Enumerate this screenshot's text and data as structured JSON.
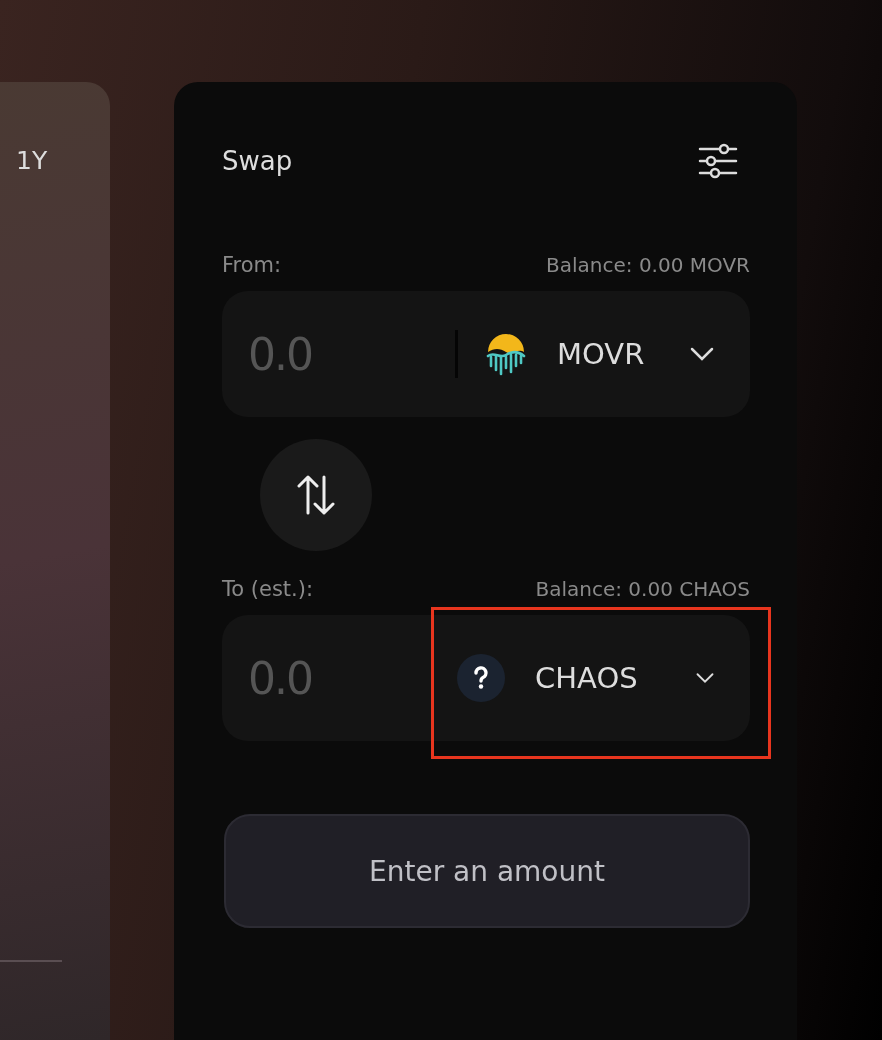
{
  "side_panel": {
    "period": "1Y"
  },
  "swap": {
    "title": "Swap",
    "from": {
      "label": "From:",
      "balance": "Balance: 0.00 MOVR",
      "placeholder": "0.0",
      "token": {
        "symbol": "MOVR",
        "kind": "movr"
      },
      "highlighted": false
    },
    "to": {
      "label": "To (est.):",
      "balance": "Balance: 0.00 CHAOS",
      "placeholder": "0.0",
      "token": {
        "symbol": "CHAOS",
        "kind": "unknown"
      },
      "highlighted": true
    },
    "submit": {
      "label": "Enter an amount",
      "disabled": true
    }
  }
}
